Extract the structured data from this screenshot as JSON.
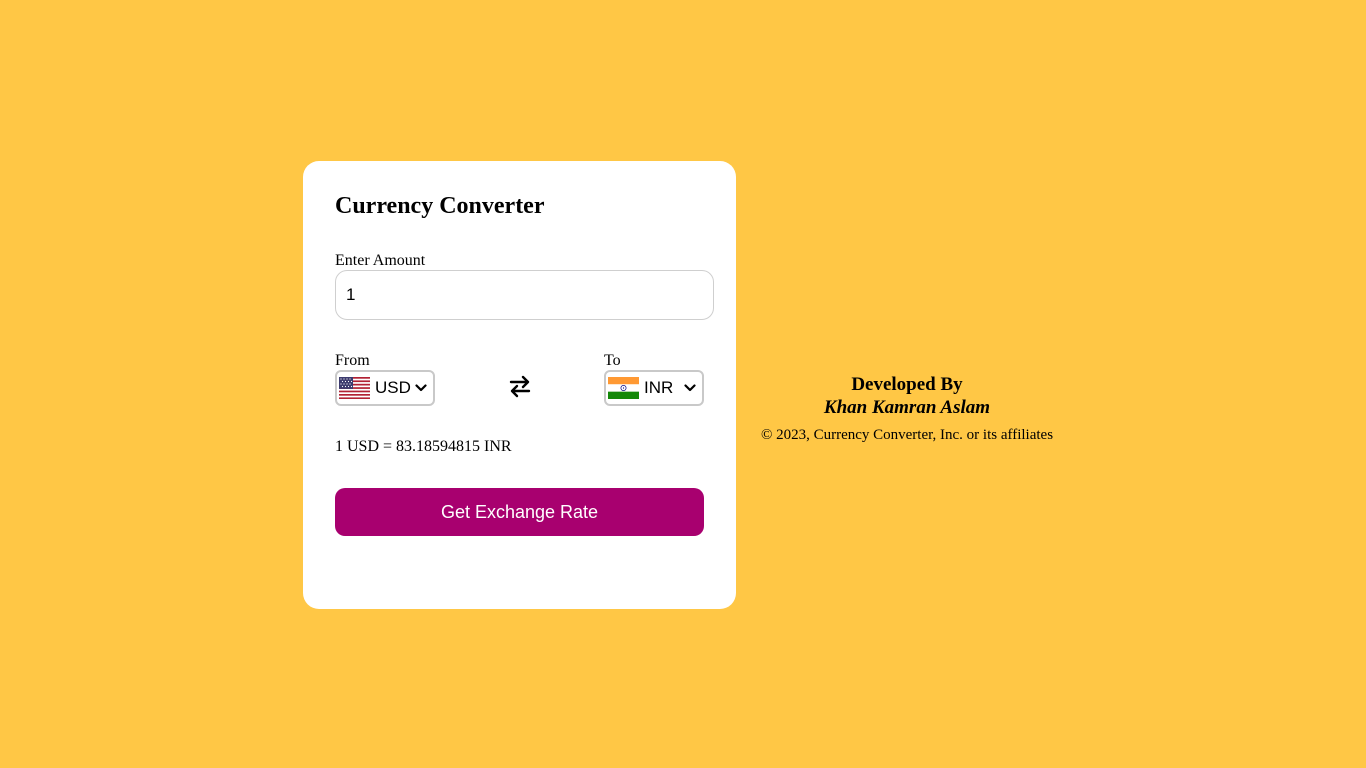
{
  "converter": {
    "title": "Currency Converter",
    "amount_label": "Enter Amount",
    "amount_value": "1",
    "from_label": "From",
    "to_label": "To",
    "from_currency": {
      "code": "USD",
      "flag_icon": "us-flag-icon"
    },
    "to_currency": {
      "code": "INR",
      "flag_icon": "india-flag-icon"
    },
    "rate_text": "1 USD = 83.18594815 INR",
    "button_label": "Get Exchange Rate"
  },
  "footer": {
    "developed_by": "Developed By",
    "developer_name": "Khan Kamran Aslam",
    "copyright": "© 2023, Currency Converter, Inc. or its affiliates"
  },
  "colors": {
    "background": "#FFC745",
    "card": "#FFFFFF",
    "button": "#A8006F",
    "button_text": "#FFFFFF"
  }
}
